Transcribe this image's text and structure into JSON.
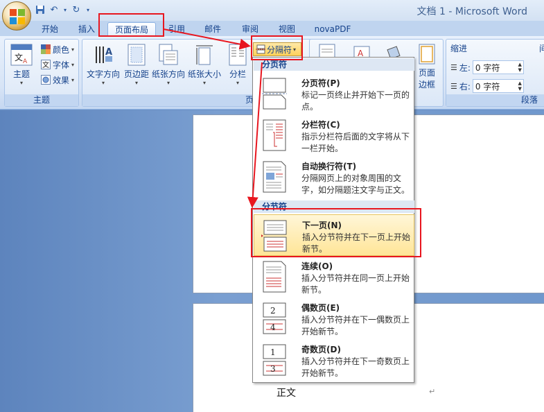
{
  "window": {
    "title": "文档 1 - Microsoft Word"
  },
  "tabs": [
    {
      "label": "开始"
    },
    {
      "label": "插入"
    },
    {
      "label": "页面布局"
    },
    {
      "label": "引用"
    },
    {
      "label": "邮件"
    },
    {
      "label": "审阅"
    },
    {
      "label": "视图"
    },
    {
      "label": "novaPDF"
    }
  ],
  "ribbon": {
    "theme_group": {
      "label": "主题",
      "theme_button": "主题",
      "colors": "颜色",
      "fonts": "字体",
      "effects": "效果"
    },
    "page_setup_group": {
      "label": "页面设置",
      "text_direction": "文字方向",
      "margins": "页边距",
      "orientation": "纸张方向",
      "size": "纸张大小",
      "columns": "分栏",
      "breaks": "分隔符"
    },
    "page_bg_group": {
      "page_borders_line1": "页面",
      "page_borders_line2": "边框"
    },
    "paragraph_group": {
      "indent_label": "缩进",
      "spacing_label_partial": "间",
      "left_label": "左:",
      "left_value": "0 字符",
      "right_label": "右:",
      "right_value": "0 字符",
      "label": "段落"
    }
  },
  "breaks_menu": {
    "page_breaks_header": "分页符",
    "section_breaks_header": "分节符",
    "items": [
      {
        "title": "分页符(P)",
        "desc": "标记一页终止并开始下一页的点。"
      },
      {
        "title": "分栏符(C)",
        "desc": "指示分栏符后面的文字将从下一栏开始。"
      },
      {
        "title": "自动换行符(T)",
        "desc": "分隔网页上的对象周围的文字，如分隔题注文字与正文。"
      },
      {
        "title": "下一页(N)",
        "desc": "插入分节符并在下一页上开始新节。"
      },
      {
        "title": "连续(O)",
        "desc": "插入分节符并在同一页上开始新节。"
      },
      {
        "title": "偶数页(E)",
        "desc": "插入分节符并在下一偶数页上开始新节。"
      },
      {
        "title": "奇数页(D)",
        "desc": "插入分节符并在下一奇数页上开始新节。"
      }
    ]
  },
  "document": {
    "body_text": "正文",
    "paragraph_mark": "↵"
  },
  "colors": {
    "ribbon_text": "#15428b",
    "annotation_red": "#e8161f",
    "hover_fill": "#ffe597"
  }
}
